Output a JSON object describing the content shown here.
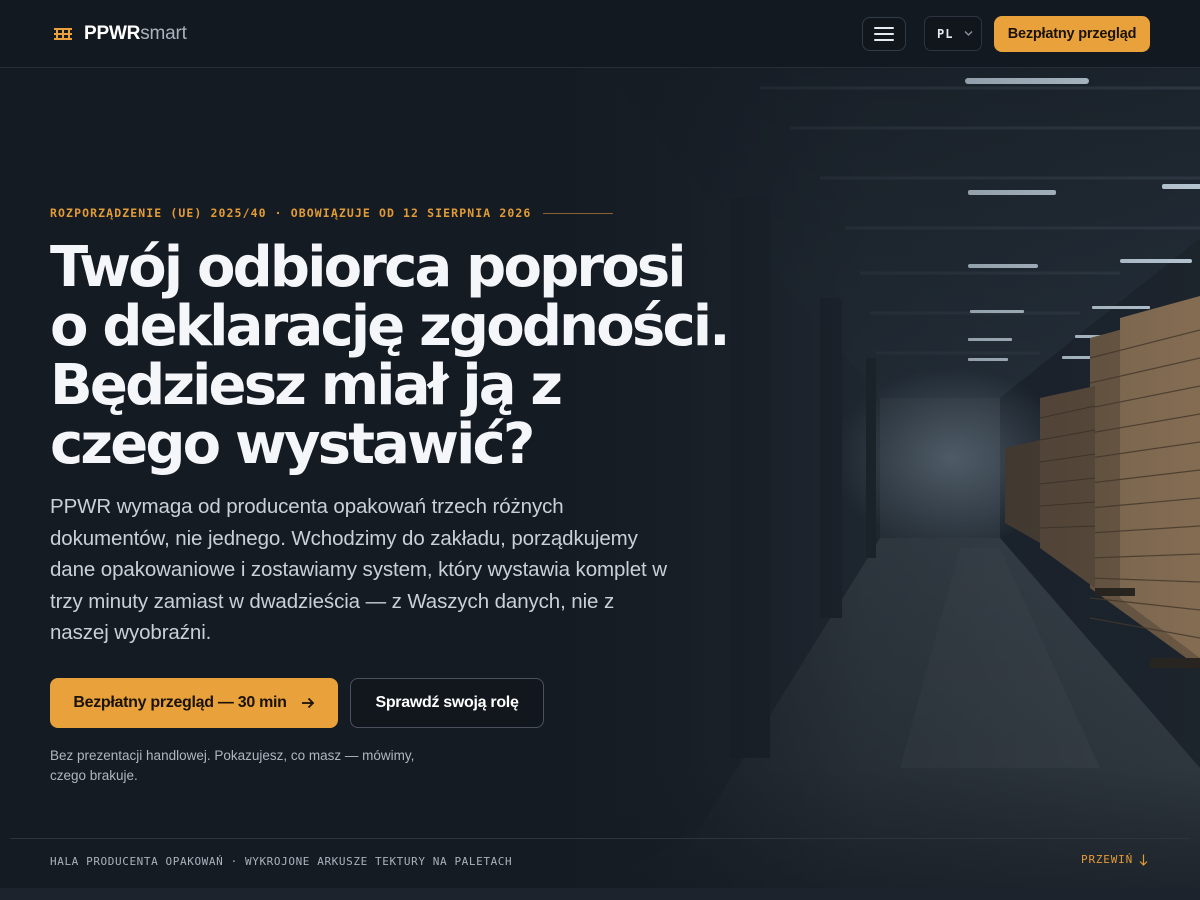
{
  "header": {
    "logo_bold": "PPWR",
    "logo_light": "smart",
    "logo_icon": "pallet-stack-icon",
    "menu_icon": "hamburger-menu-icon",
    "language": "PL",
    "cta_label": "Bezpłatny przegląd"
  },
  "hero": {
    "eyebrow": "ROZPORZĄDZENIE (UE) 2025/40 · OBOWIĄZUJE OD 12 SIERPNIA 2026",
    "headline": [
      "Twój odbiorca poprosi",
      "o deklarację zgodności.",
      "Będziesz miał ją z",
      "czego wystawić?"
    ],
    "lead": "PPWR wymaga od producenta opakowań trzech różnych dokumentów, nie jednego. Wchodzimy do zakładu, porządkujemy dane opakowaniowe i zostawiamy system, który wystawia komplet w trzy minuty zamiast w dwadzieścia — z Waszych danych, nie z naszej wyobraźni.",
    "primary_button": "Bezpłatny przegląd — 30 min",
    "secondary_button": "Sprawdź swoją rolę",
    "note": "Bez prezentacji handlowej. Pokazujesz, co masz — mówimy, czego brakuje."
  },
  "footer_strip": {
    "caption": "HALA PRODUCENTA OPAKOWAŃ · WYKROJONE ARKUSZE TEKTURY NA PALETACH",
    "scroll_label": "PRZEWIŃ"
  },
  "colors": {
    "accent": "#e9a23b",
    "background": "#141a21",
    "text": "#f4f6f9"
  }
}
